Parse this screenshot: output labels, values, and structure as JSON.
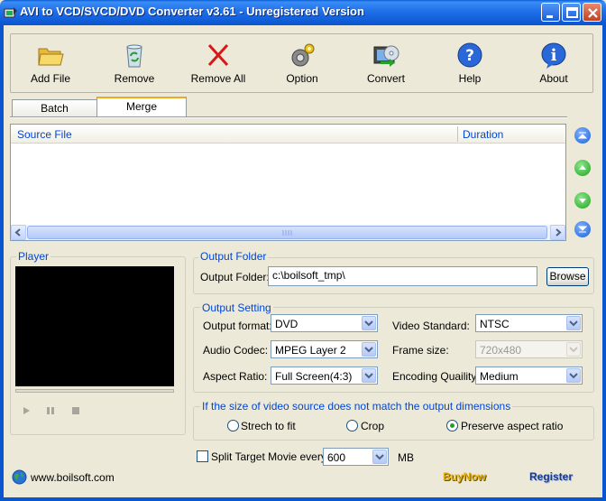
{
  "window": {
    "title": "AVI to VCD/SVCD/DVD Converter v3.61 - Unregistered Version"
  },
  "toolbar": {
    "add_file": "Add File",
    "remove": "Remove",
    "remove_all": "Remove All",
    "option": "Option",
    "convert": "Convert",
    "help": "Help",
    "about": "About"
  },
  "tabs": [
    {
      "label": "Batch",
      "active": false
    },
    {
      "label": "Merge",
      "active": true
    }
  ],
  "file_list": {
    "columns": [
      "Source File",
      "Duration"
    ],
    "rows": []
  },
  "player": {
    "title": "Player"
  },
  "output_folder": {
    "group_title": "Output Folder",
    "label": "Output Folder:",
    "value": "c:\\boilsoft_tmp\\",
    "browse": "Browse"
  },
  "output_setting": {
    "group_title": "Output Setting",
    "format_label": "Output format:",
    "format_value": "DVD",
    "audio_label": "Audio Codec:",
    "audio_value": "MPEG Layer 2",
    "aspect_label": "Aspect Ratio:",
    "aspect_value": "Full Screen(4:3)",
    "standard_label": "Video Standard:",
    "standard_value": "NTSC",
    "frame_label": "Frame size:",
    "frame_value": "720x480",
    "quality_label": "Encoding Quaility:",
    "quality_value": "Medium"
  },
  "dimension": {
    "group_title": "If  the size of video source does not match the output dimensions",
    "options": [
      "Strech to fit",
      "Crop",
      "Preserve aspect ratio"
    ],
    "selected": "Preserve aspect ratio"
  },
  "split": {
    "label": "Split Target Movie every",
    "checked": false,
    "value": "600",
    "unit": "MB"
  },
  "footer": {
    "website": "www.boilsoft.com",
    "buy_now": "BuyNow",
    "register": "Register"
  },
  "colors": {
    "title_bar": "#0a55d0",
    "group_title": "#0046d5",
    "buy_now": "#e8b000",
    "register": "#1a3a8a"
  }
}
